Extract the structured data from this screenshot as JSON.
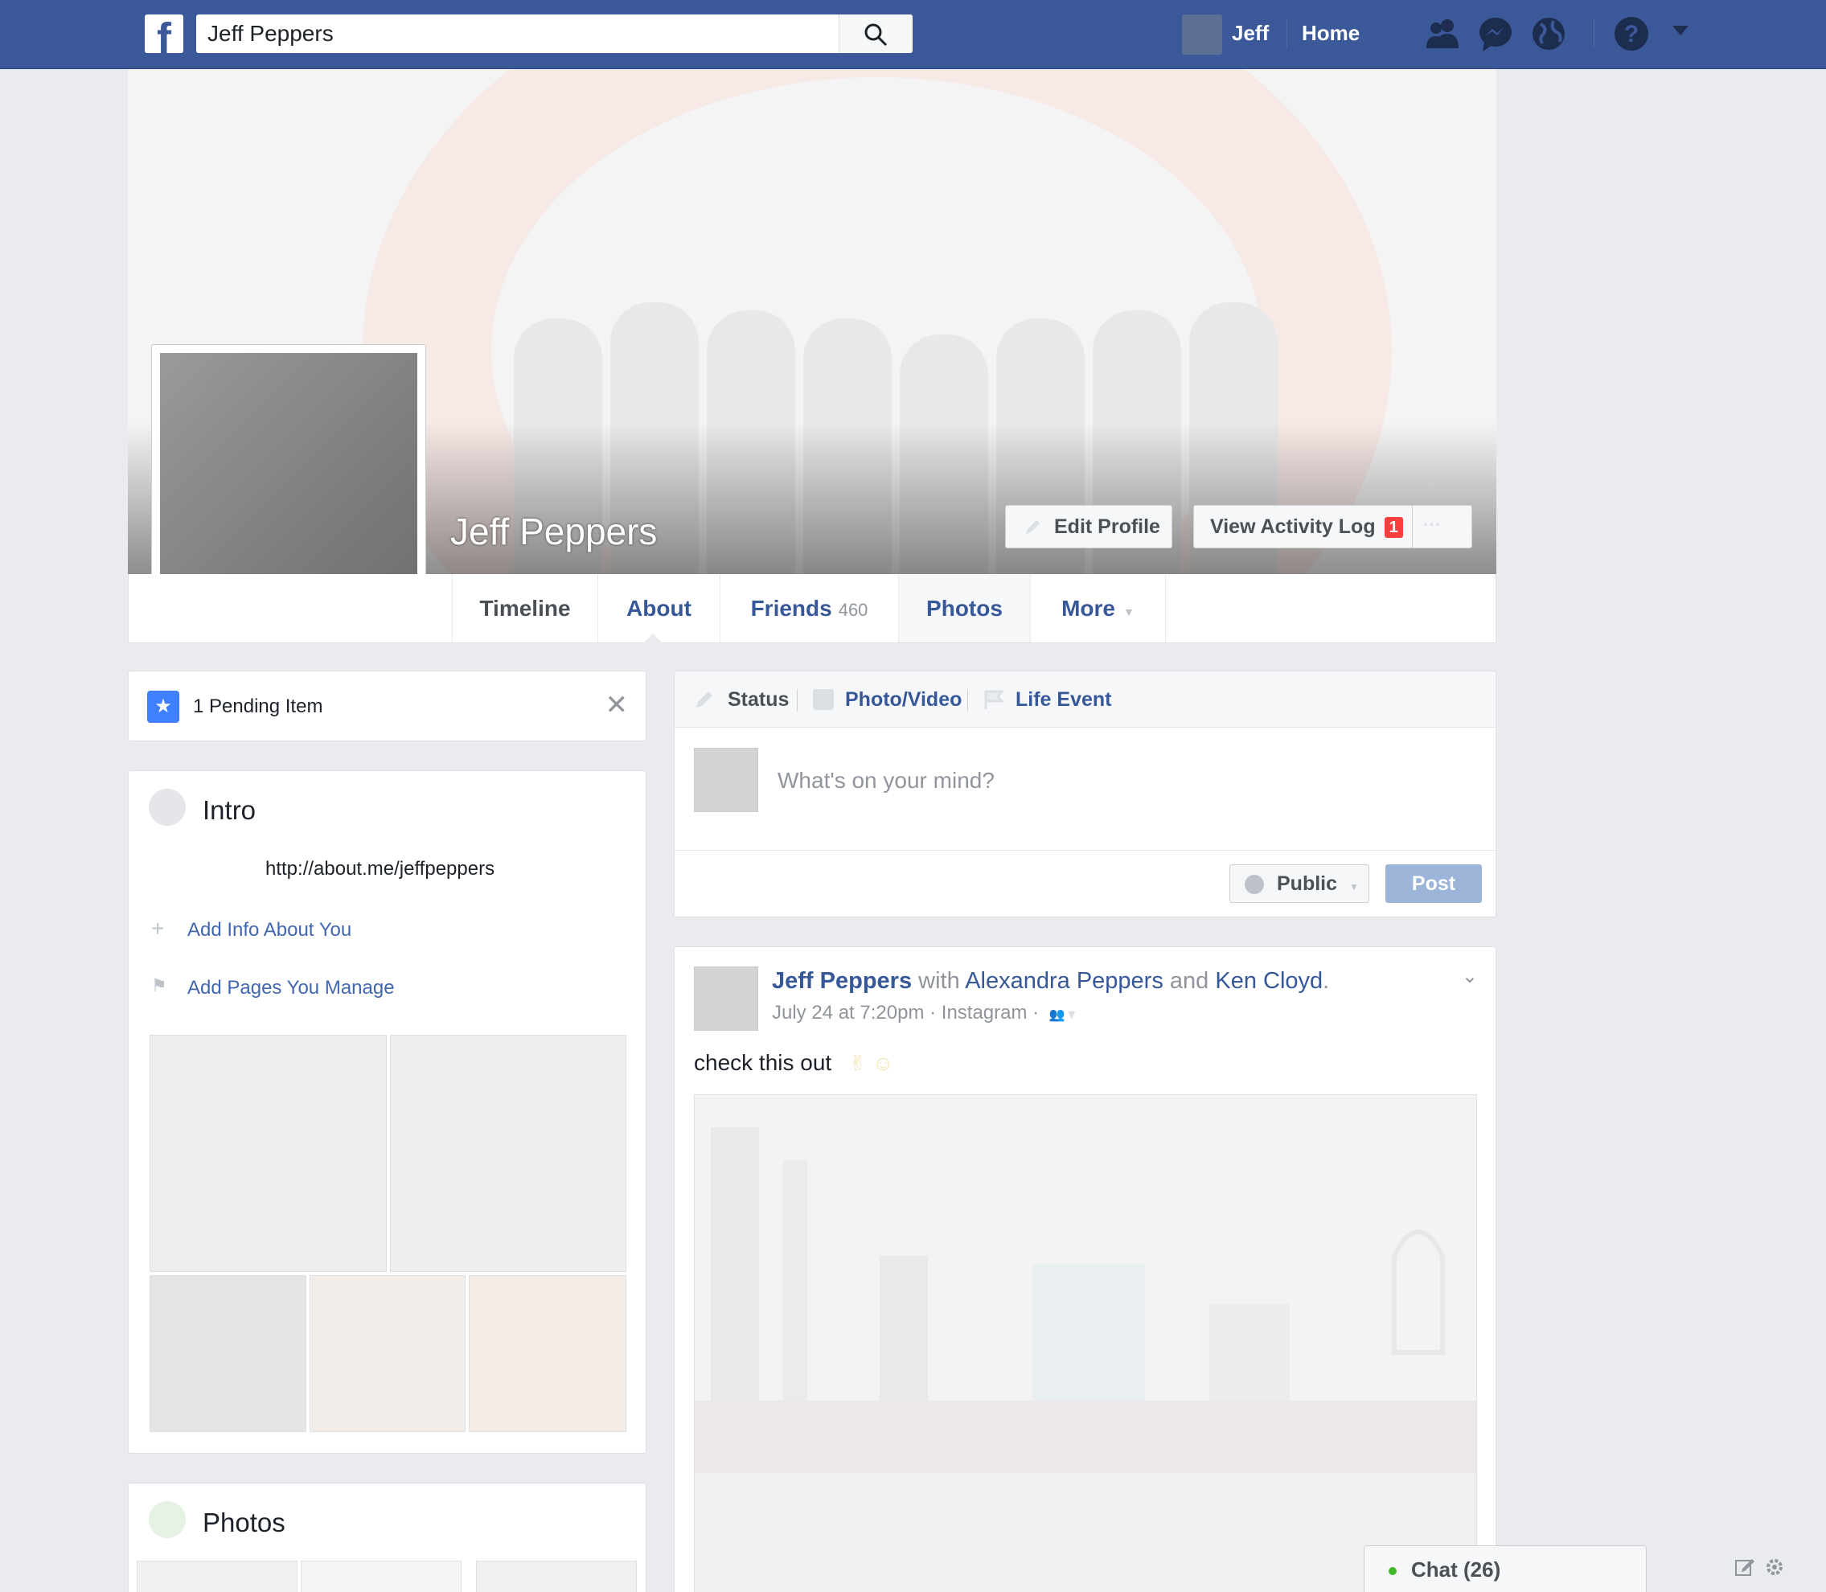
{
  "topbar": {
    "logo": "f",
    "search_value": "Jeff Peppers",
    "user_name": "Jeff",
    "home_label": "Home",
    "icons": [
      "friend-requests-icon",
      "messenger-icon",
      "notifications-globe-icon",
      "help-icon",
      "account-menu-caret-icon"
    ]
  },
  "profile": {
    "name": "Jeff Peppers",
    "edit_profile_label": "Edit Profile",
    "activity_log_label": "View Activity Log",
    "activity_log_badge": "1",
    "more_options_label": "···"
  },
  "tabs": [
    {
      "label": "Timeline"
    },
    {
      "label": "About"
    },
    {
      "label": "Friends",
      "count": "460"
    },
    {
      "label": "Photos"
    },
    {
      "label": "More"
    }
  ],
  "pending": {
    "label": "1 Pending Item",
    "close": "✕"
  },
  "intro": {
    "title": "Intro",
    "url": "http://about.me/jeffpeppers",
    "add_info_label": "Add Info About You",
    "add_pages_label": "Add Pages You Manage"
  },
  "photos_card": {
    "title": "Photos"
  },
  "composer": {
    "tabs": [
      "Status",
      "Photo/Video",
      "Life Event"
    ],
    "placeholder": "What's on your mind?",
    "audience_label": "Public",
    "post_label": "Post"
  },
  "post": {
    "author": "Jeff Peppers",
    "with_word": "with",
    "tagged_1": "Alexandra Peppers",
    "and_word": "and",
    "tagged_2": "Ken Cloyd",
    "period": ".",
    "meta": "July 24 at 7:20pm · Instagram ·",
    "text": "check this out"
  },
  "chat": {
    "label": "Chat (26)"
  },
  "colors": {
    "brand_blue": "#3b5998",
    "link_blue": "#365899",
    "background": "#e9ebee",
    "badge_red": "#fa3e3e"
  }
}
